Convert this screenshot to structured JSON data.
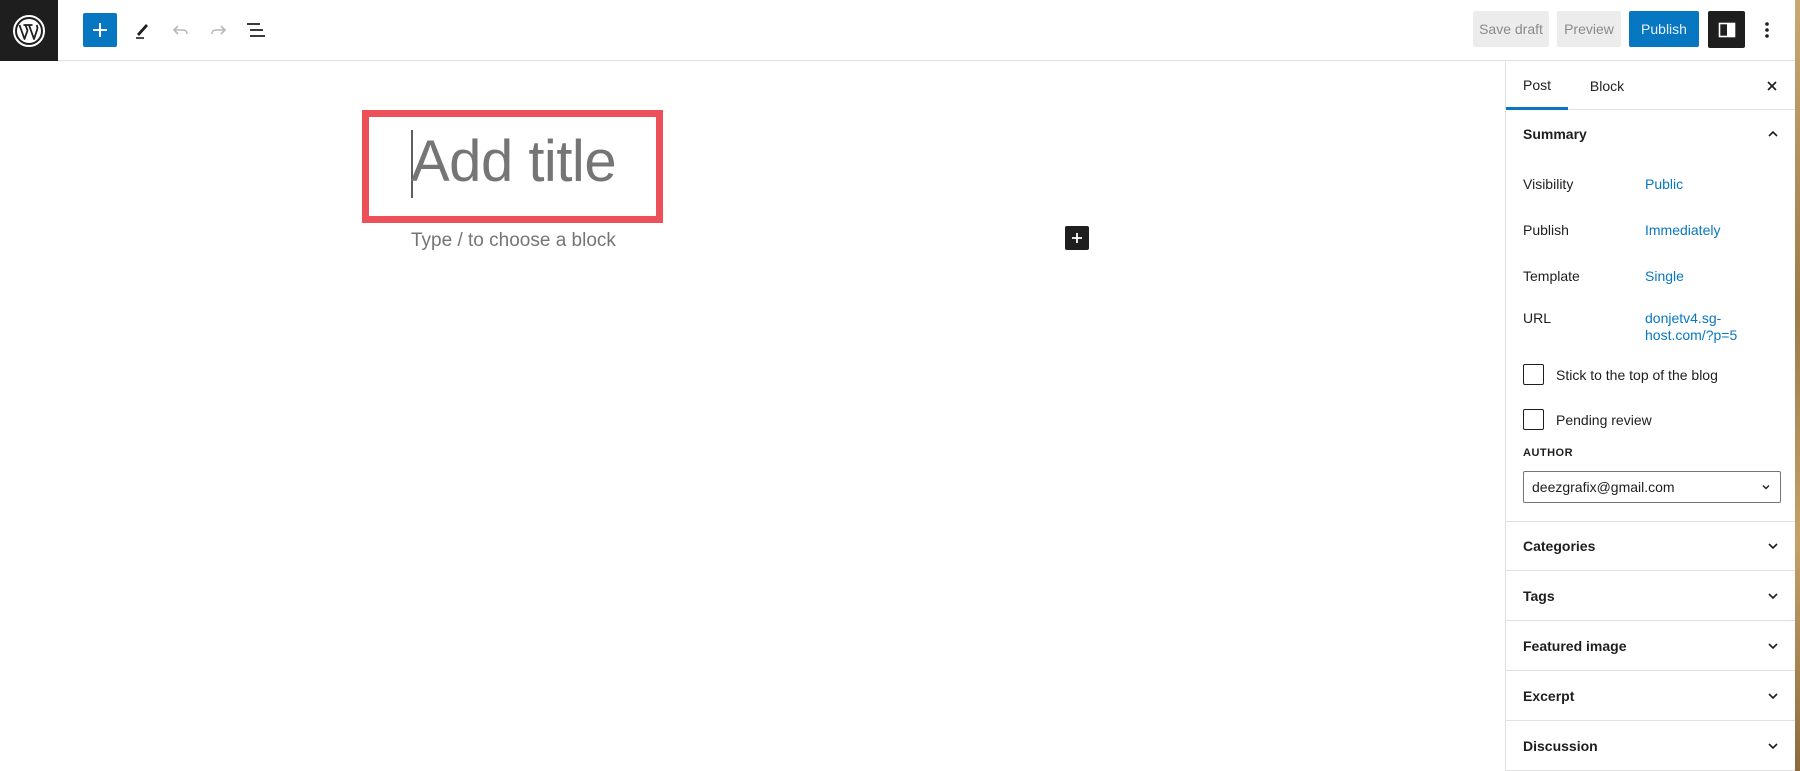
{
  "toolbar": {
    "wp_logo": "wordpress-logo-icon",
    "inserter_icon": "plus-icon",
    "tools_icon": "pencil-icon",
    "undo_icon": "undo-icon",
    "redo_icon": "redo-icon",
    "list_view_icon": "list-view-icon",
    "save_draft_label": "Save draft",
    "preview_label": "Preview",
    "publish_label": "Publish",
    "settings_icon": "sidebar-toggle-icon",
    "more_icon": "more-vertical-icon"
  },
  "editor": {
    "title_placeholder": "Add title",
    "block_placeholder": "Type / to choose a block",
    "block_add_icon": "plus-icon"
  },
  "sidebar": {
    "tabs": [
      {
        "label": "Post",
        "active": true
      },
      {
        "label": "Block",
        "active": false
      }
    ],
    "close_icon": "close-icon",
    "summary": {
      "title": "Summary",
      "expanded": true,
      "rows": [
        {
          "label": "Visibility",
          "value": "Public"
        },
        {
          "label": "Publish",
          "value": "Immediately"
        },
        {
          "label": "Template",
          "value": "Single"
        },
        {
          "label": "URL",
          "value_line1": "donjetv4.sg-",
          "value_line2": "host.com/?p=5"
        }
      ],
      "checkboxes": [
        {
          "label": "Stick to the top of the blog",
          "checked": false
        },
        {
          "label": "Pending review",
          "checked": false
        }
      ],
      "author_label": "AUTHOR",
      "author_value": "deezgrafix@gmail.com"
    },
    "panels": [
      {
        "title": "Categories"
      },
      {
        "title": "Tags"
      },
      {
        "title": "Featured image"
      },
      {
        "title": "Excerpt"
      },
      {
        "title": "Discussion"
      }
    ]
  },
  "colors": {
    "accent": "#0877c2",
    "highlight": "#ec5058",
    "dark": "#1e1e1e"
  }
}
